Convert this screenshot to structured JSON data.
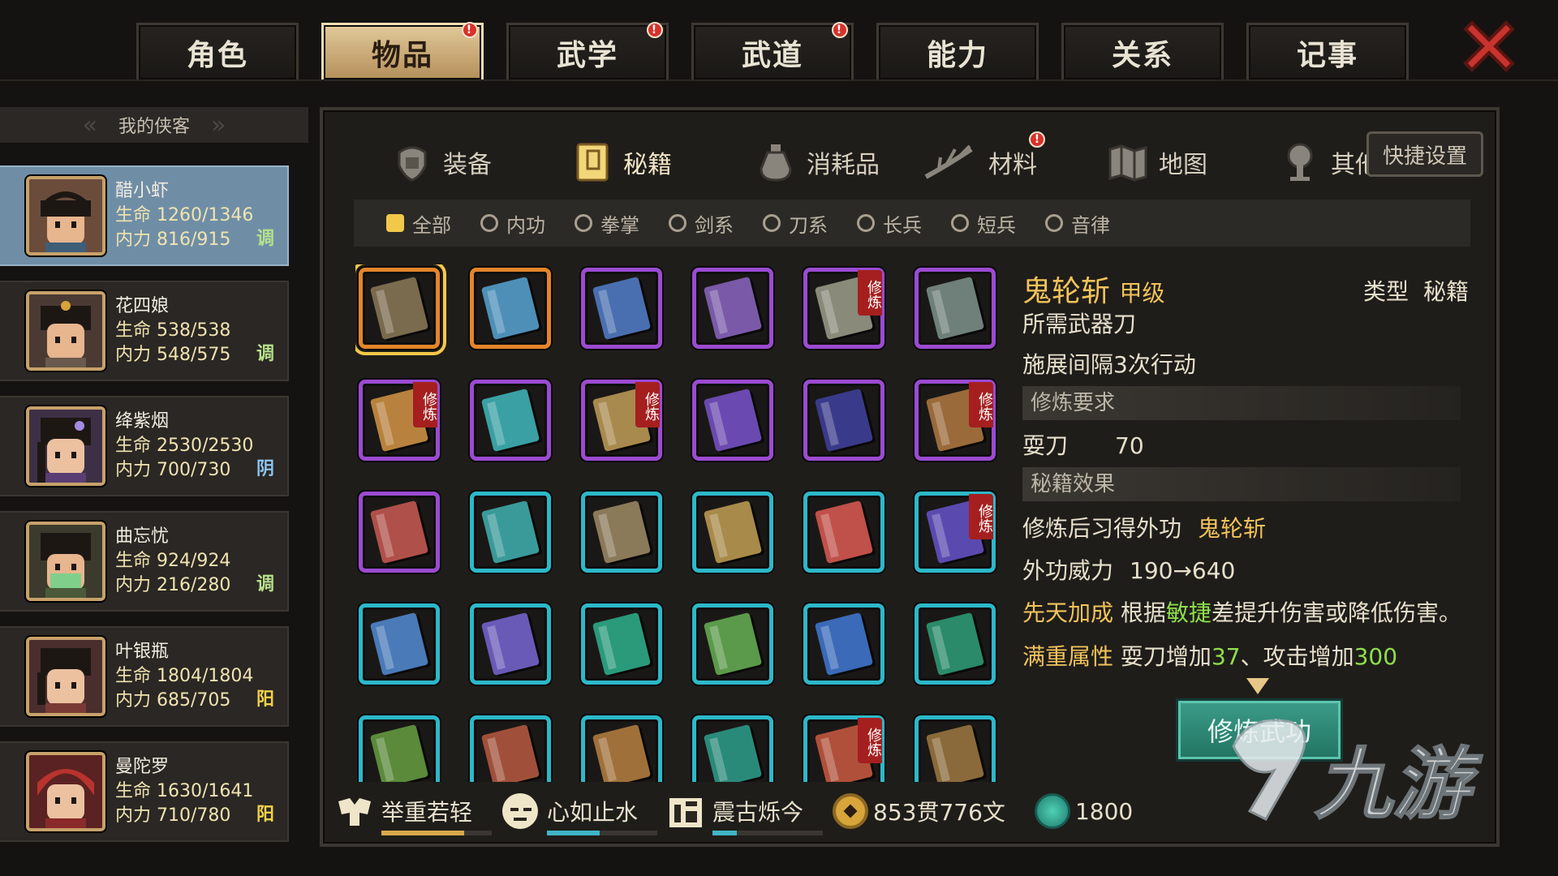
{
  "top_tabs": [
    {
      "label": "角色",
      "badge": false,
      "active": false
    },
    {
      "label": "物品",
      "badge": true,
      "active": true
    },
    {
      "label": "武学",
      "badge": true,
      "active": false
    },
    {
      "label": "武道",
      "badge": true,
      "active": false
    },
    {
      "label": "能力",
      "badge": false,
      "active": false
    },
    {
      "label": "关系",
      "badge": false,
      "active": false
    },
    {
      "label": "记事",
      "badge": false,
      "active": false
    }
  ],
  "badge_mark": "!",
  "roster": {
    "header": "我的侠客",
    "characters": [
      {
        "name": "醋小虾",
        "hp": "生命 1260/1346",
        "mp": "内力 816/915",
        "tag": "调",
        "active": true
      },
      {
        "name": "花四娘",
        "hp": "生命 538/538",
        "mp": "内力 548/575",
        "tag": "调",
        "active": false
      },
      {
        "name": "绛紫烟",
        "hp": "生命 2530/2530",
        "mp": "内力 700/730",
        "tag": "阴",
        "active": false
      },
      {
        "name": "曲忘忧",
        "hp": "生命 924/924",
        "mp": "内力 216/280",
        "tag": "调",
        "active": false
      },
      {
        "name": "叶银瓶",
        "hp": "生命 1804/1804",
        "mp": "内力 685/705",
        "tag": "阳",
        "active": false
      },
      {
        "name": "曼陀罗",
        "hp": "生命 1630/1641",
        "mp": "内力 710/780",
        "tag": "阳",
        "active": false
      }
    ]
  },
  "sub_tabs": [
    {
      "label": "装备",
      "icon": "armor-icon",
      "badge": false
    },
    {
      "label": "秘籍",
      "icon": "book-icon",
      "badge": false,
      "active": true
    },
    {
      "label": "消耗品",
      "icon": "potion-icon",
      "badge": false
    },
    {
      "label": "材料",
      "icon": "herb-icon",
      "badge": true
    },
    {
      "label": "地图",
      "icon": "map-icon",
      "badge": false
    },
    {
      "label": "其他",
      "icon": "bell-icon",
      "badge": true
    }
  ],
  "quick_settings": "快捷设置",
  "filters": [
    "全部",
    "内功",
    "拳掌",
    "剑系",
    "刀系",
    "长兵",
    "短兵",
    "音律"
  ],
  "training_badge": "修炼",
  "detail": {
    "name": "鬼轮斩",
    "grade": "甲级",
    "type_label": "类型",
    "type_value": "秘籍",
    "weapon_req": "所需武器刀",
    "interval": "施展间隔3次行动",
    "section_req": "修炼要求",
    "req_name": "耍刀",
    "req_value": "70",
    "section_effect": "秘籍效果",
    "learn_prefix": "修炼后习得外功",
    "learn_skill": "鬼轮斩",
    "power_label": "外功威力",
    "power_value": "190→640",
    "innate_label": "先天加成",
    "innate_pre": "根据",
    "innate_attr": "敏捷",
    "innate_post": "差提升伤害或降低伤害。",
    "full_label": "满重属性",
    "full_pre": "耍刀增加",
    "full_val1": "37",
    "full_mid": "、攻击增加",
    "full_val2": "300"
  },
  "train_button": "修炼武功",
  "bottom": {
    "stat1": "举重若轻",
    "stat2": "心如止水",
    "stat3": "震古烁今",
    "money": "853贯776文",
    "jade": "1800"
  },
  "watermark": "九游",
  "colors": {
    "purple": "#9b4bd1",
    "cyan": "#2db8c9",
    "orange": "#e3852a",
    "gold": "#f2c35a",
    "green": "#8ee04b"
  }
}
